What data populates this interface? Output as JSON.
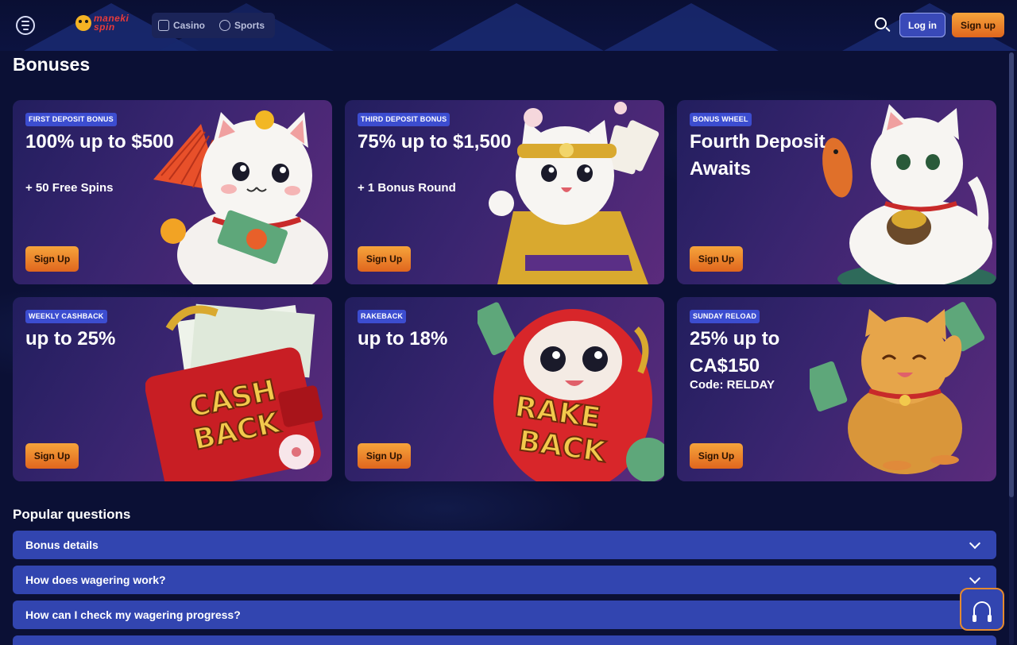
{
  "header": {
    "logo_lines": [
      "maneki",
      "spin"
    ],
    "nav": [
      {
        "label": "Casino",
        "icon": "cards-icon"
      },
      {
        "label": "Sports",
        "icon": "ball-icon"
      }
    ],
    "login_label": "Log in",
    "signup_label": "Sign up"
  },
  "page_title": "Bonuses",
  "cards": [
    {
      "badge": "FIRST DEPOSIT BONUS",
      "headline": "100% up to $500",
      "subline": "+ 50 Free Spins",
      "cta": "Sign Up"
    },
    {
      "badge": "THIRD DEPOSIT BONUS",
      "headline": "75% up to $1,500",
      "subline": "+ 1 Bonus Round",
      "cta": "Sign Up"
    },
    {
      "badge": "BONUS WHEEL",
      "headline": "Fourth Deposit Awaits",
      "subline": "",
      "cta": "Sign Up"
    },
    {
      "badge": "WEEKLY CASHBACK",
      "headline": "up to 25%",
      "subline": "",
      "cta": "Sign Up"
    },
    {
      "badge": "RAKEBACK",
      "headline": "up to 18%",
      "subline": "",
      "cta": "Sign Up"
    },
    {
      "badge": "SUNDAY RELOAD",
      "headline": "25% up to CA$150",
      "subline": "Code: RELDAY",
      "cta": "Sign Up"
    }
  ],
  "faq_title": "Popular questions",
  "faq": [
    "Bonus details",
    "How does wagering work?",
    "How can I check my wagering progress?",
    ""
  ],
  "colors": {
    "background": "#0b1035",
    "accent_orange": "#f29a35",
    "accent_blue": "#3245b0",
    "badge_blue": "#3c4dd0"
  }
}
